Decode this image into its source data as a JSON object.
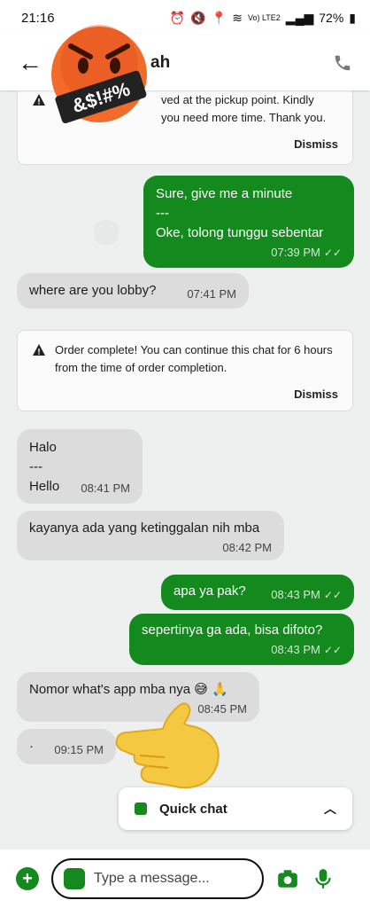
{
  "status_bar": {
    "time": "21:16",
    "network": "Vo) LTE2",
    "battery": "72%"
  },
  "header": {
    "title_partial": "ah"
  },
  "notices": [
    {
      "text": "ved at the pickup point. Kindly\nyou need more time. Thank you.",
      "dismiss": "Dismiss"
    },
    {
      "text": "Order complete! You can continue this chat for 6 hours from the time of order completion.",
      "dismiss": "Dismiss"
    }
  ],
  "messages": [
    {
      "dir": "out",
      "lines": [
        "Sure, give me a minute",
        "---",
        "Oke, tolong tunggu sebentar"
      ],
      "time": "07:39 PM"
    },
    {
      "dir": "in",
      "lines": [
        "where are you lobby?"
      ],
      "time": "07:41 PM"
    },
    {
      "dir": "in",
      "lines": [
        "Halo",
        "---",
        "Hello"
      ],
      "time": "08:41 PM"
    },
    {
      "dir": "in",
      "lines": [
        "kayanya ada yang ketinggalan nih mba"
      ],
      "time": "08:42 PM"
    },
    {
      "dir": "out",
      "lines": [
        "apa ya pak?"
      ],
      "time": "08:43 PM"
    },
    {
      "dir": "out",
      "lines": [
        "sepertinya ga ada, bisa difoto?"
      ],
      "time": "08:43 PM"
    },
    {
      "dir": "in",
      "lines": [
        "Nomor what's app mba nya 😅 🙏"
      ],
      "time": "08:45 PM"
    },
    {
      "dir": "in",
      "lines": [
        "·"
      ],
      "time": "09:15 PM"
    }
  ],
  "quick_chat": {
    "label": "Quick chat"
  },
  "input": {
    "placeholder": "Type a message..."
  },
  "stickers": {
    "angry_text": "&$!#%"
  },
  "colors": {
    "brand_green": "#148a1e",
    "incoming_bubble": "#dcdcdc",
    "background": "#eef0ef"
  }
}
